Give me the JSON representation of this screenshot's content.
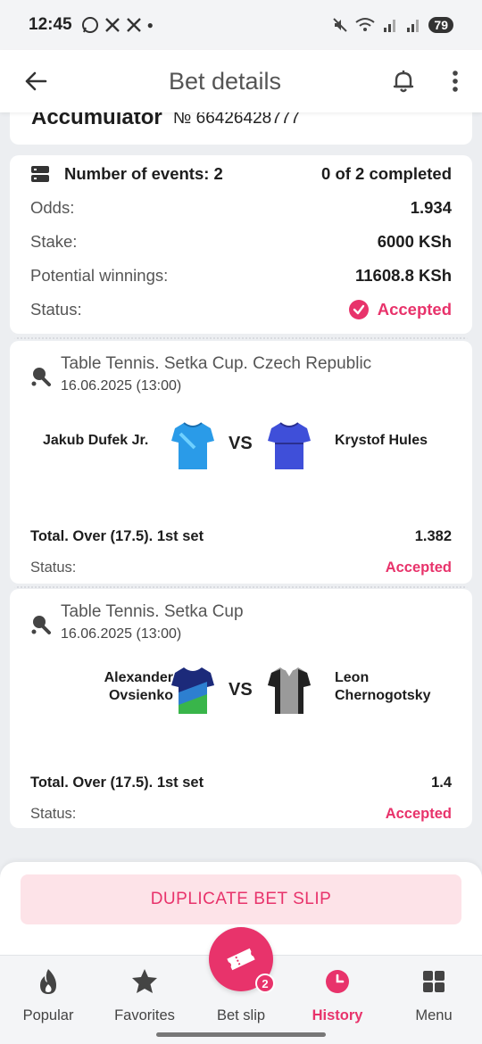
{
  "status_bar": {
    "time": "12:45",
    "battery": "79"
  },
  "header": {
    "title": "Bet details"
  },
  "bet": {
    "type": "Accumulator",
    "number": "№ 66426428777",
    "events_label": "Number of events: 2",
    "completed": "0 of 2 completed",
    "rows": [
      {
        "label": "Odds:",
        "value": "1.934"
      },
      {
        "label": "Stake:",
        "value": "6000 KSh"
      },
      {
        "label": "Potential winnings:",
        "value": "11608.8 KSh"
      }
    ],
    "status_label": "Status:",
    "status_value": "Accepted"
  },
  "events": [
    {
      "league": "Table Tennis. Setka Cup. Czech Republic",
      "date": "16.06.2025 (13:00)",
      "team1": "Jakub Dufek Jr.",
      "team2": "Krystof Hules",
      "vs": "VS",
      "bet": "Total. Over (17.5). 1st set",
      "odds": "1.382",
      "status_label": "Status:",
      "status": "Accepted",
      "jersey1_color": "#2a9be8",
      "jersey2_color": "#3f4fd9"
    },
    {
      "league": "Table Tennis. Setka Cup",
      "date": "16.06.2025 (13:00)",
      "team1_line1": "Alexander",
      "team1_line2": "Ovsienko",
      "team2_line1": "Leon",
      "team2_line2": "Chernogotsky",
      "vs": "VS",
      "bet": "Total. Over (17.5). 1st set",
      "odds": "1.4",
      "status_label": "Status:",
      "status": "Accepted",
      "jersey1_color": "#1c2a7a",
      "jersey2_color": "#9a9a9a"
    }
  ],
  "actions": {
    "duplicate": "DUPLICATE BET SLIP"
  },
  "nav": {
    "items": [
      {
        "label": "Popular",
        "icon": "flame-icon"
      },
      {
        "label": "Favorites",
        "icon": "star-icon"
      },
      {
        "label": "Bet slip",
        "icon": "ticket-icon"
      },
      {
        "label": "History",
        "icon": "clock-icon"
      },
      {
        "label": "Menu",
        "icon": "grid-icon"
      }
    ],
    "betslip_count": "2",
    "active": "History"
  },
  "colors": {
    "accent": "#e8336b",
    "background": "#eceef1"
  }
}
